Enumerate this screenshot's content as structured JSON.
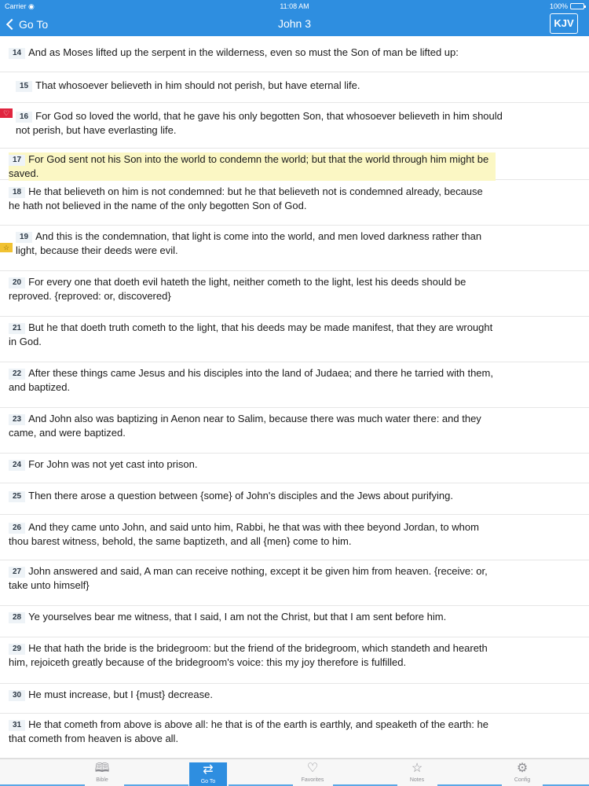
{
  "status_bar": {
    "carrier": "Carrier",
    "time": "11:08 AM",
    "battery": "100%"
  },
  "nav": {
    "back_label": "Go To",
    "title": "John 3",
    "version": "KJV"
  },
  "verses": [
    {
      "num": "14",
      "text": "And as Moses lifted up the serpent in the wilderness, even so must the Son of man be lifted up:"
    },
    {
      "num": "15",
      "text": "That whosoever believeth in him should not perish, but have eternal life."
    },
    {
      "num": "16",
      "text": "For God so loved the world, that he gave his only begotten Son, that whosoever believeth in him should not perish, but have everlasting life.",
      "marker": "favorite"
    },
    {
      "num": "17",
      "text": "For God sent not his Son into the world to condemn the world; but that the world through him might be saved.",
      "highlighted": true
    },
    {
      "num": "18",
      "text": "He that believeth on him is not condemned: but he that believeth not is condemned already, because he hath not believed in the name of the only begotten Son of God."
    },
    {
      "num": "19",
      "text": "And this is the condemnation, that light is come into the world, and men loved darkness rather than light, because their deeds were evil.",
      "marker": "starred"
    },
    {
      "num": "20",
      "text": "For every one that doeth evil hateth the light, neither cometh to the light, lest his deeds should be reproved. {reproved: or, discovered}"
    },
    {
      "num": "21",
      "text": "But he that doeth truth cometh to the light, that his deeds may be made manifest, that they are wrought in God."
    },
    {
      "num": "22",
      "text": "After these things came Jesus and his disciples into the land of Judaea; and there he tarried with them, and baptized."
    },
    {
      "num": "23",
      "text": "And John also was baptizing in Aenon near to Salim, because there was much water there: and they came, and were baptized."
    },
    {
      "num": "24",
      "text": "For John was not yet cast into prison."
    },
    {
      "num": "25",
      "text": "Then there arose a question between {some} of John's disciples and the Jews about purifying."
    },
    {
      "num": "26",
      "text": "And they came unto John, and said unto him, Rabbi, he that was with thee beyond Jordan, to whom thou barest witness, behold, the same baptizeth, and all {men} come to him."
    },
    {
      "num": "27",
      "text": "John answered and said, A man can receive nothing, except it be given him from heaven. {receive: or, take unto himself}"
    },
    {
      "num": "28",
      "text": "Ye yourselves bear me witness, that I said, I am not the Christ, but that I am sent before him."
    },
    {
      "num": "29",
      "text": "He that hath the bride is the bridegroom: but the friend of the bridegroom, which standeth and heareth him, rejoiceth greatly because of the bridegroom's voice: this my joy therefore is fulfilled."
    },
    {
      "num": "30",
      "text": "He must increase, but I {must} decrease."
    },
    {
      "num": "31",
      "text": "He that cometh from above is above all: he that is of the earth is earthly, and speaketh of the earth: he that cometh from heaven is above all."
    }
  ],
  "tabs": [
    {
      "label": "Bible",
      "icon": "book-icon"
    },
    {
      "label": "Go To",
      "icon": "signpost-icon",
      "active": true
    },
    {
      "label": "Favorites",
      "icon": "heart-icon"
    },
    {
      "label": "Notes",
      "icon": "star-icon"
    },
    {
      "label": "Config",
      "icon": "gear-icon"
    }
  ],
  "colors": {
    "accent": "#2e8ee0",
    "highlight": "#fbf7c4",
    "favorite": "#e0253f",
    "starred": "#f1c232"
  }
}
